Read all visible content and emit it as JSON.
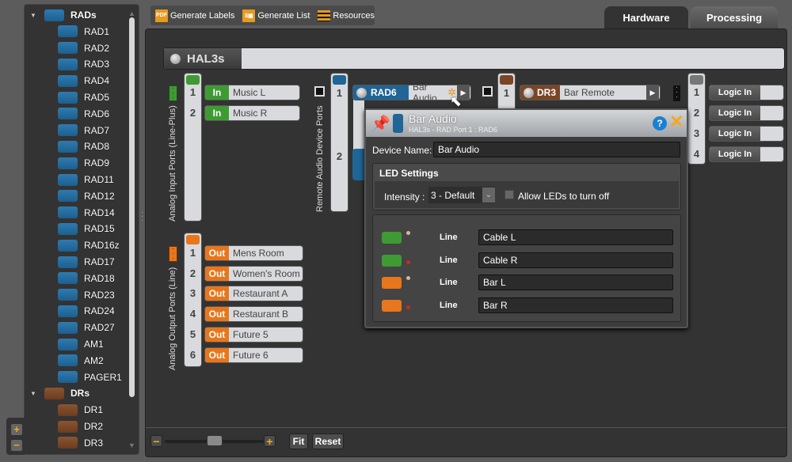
{
  "sidebar": {
    "groups": [
      {
        "label": "RADs",
        "color": "blue",
        "items": [
          "RAD1",
          "RAD2",
          "RAD3",
          "RAD4",
          "RAD5",
          "RAD6",
          "RAD7",
          "RAD8",
          "RAD9",
          "RAD11",
          "RAD12",
          "RAD14",
          "RAD15",
          "RAD16z",
          "RAD17",
          "RAD18",
          "RAD23",
          "RAD24",
          "RAD27",
          "AM1",
          "AM2",
          "PAGER1"
        ]
      },
      {
        "label": "DRs",
        "color": "brown",
        "items": [
          "DR1",
          "DR2",
          "DR3"
        ]
      }
    ],
    "add_label": "+",
    "remove_label": "−"
  },
  "toolbar": {
    "generate_labels": "Generate Labels",
    "generate_list": "Generate List",
    "resources": "Resources",
    "pdf_icon_text": "PDF",
    "list_icon_text": "$▦"
  },
  "tabs": [
    {
      "label": "Hardware",
      "active": true
    },
    {
      "label": "Processing",
      "active": false
    }
  ],
  "device": {
    "name": "HAL3s"
  },
  "inputs": {
    "title": "Analog Input Ports (Line-Plus)",
    "tag": "In",
    "ports": [
      {
        "n": "1",
        "name": "Music L"
      },
      {
        "n": "2",
        "name": "Music R"
      }
    ]
  },
  "outputs": {
    "title": "Analog Output Ports (Line)",
    "tag": "Out",
    "ports": [
      {
        "n": "1",
        "name": "Mens Room"
      },
      {
        "n": "2",
        "name": "Women's Room"
      },
      {
        "n": "3",
        "name": "Restaurant A"
      },
      {
        "n": "4",
        "name": "Restaurant B"
      },
      {
        "n": "5",
        "name": "Future 5"
      },
      {
        "n": "6",
        "name": "Future 6"
      }
    ]
  },
  "remote": {
    "title": "Remote Audio Device Ports",
    "ports": [
      "1",
      "2"
    ],
    "device": {
      "id": "RAD6",
      "name": "Bar Audio"
    }
  },
  "dr": {
    "port": "1",
    "device": {
      "id": "DR3",
      "name": "Bar Remote"
    }
  },
  "logic": {
    "ports": [
      {
        "n": "1",
        "label": "Logic In"
      },
      {
        "n": "2",
        "label": "Logic In"
      },
      {
        "n": "3",
        "label": "Logic In"
      },
      {
        "n": "4",
        "label": "Logic In"
      }
    ]
  },
  "popup": {
    "title": "Bar Audio",
    "subtitle": "HAL3s - RAD Port 1  :  RAD6",
    "device_name_label": "Device Name:",
    "device_name_value": "Bar Audio",
    "led_title": "LED Settings",
    "intensity_label": "Intensity :",
    "intensity_value": "3 - Default",
    "allow_off_label": "Allow LEDs to turn off",
    "allow_off_checked": false,
    "channels": [
      {
        "color": "#3f9a34",
        "type": "Line",
        "name": "Cable L"
      },
      {
        "color": "#3f9a34",
        "type": "Line",
        "name": "Cable R"
      },
      {
        "color": "#e8761c",
        "type": "Line",
        "name": "Bar L"
      },
      {
        "color": "#e8761c",
        "type": "Line",
        "name": "Bar R"
      }
    ]
  },
  "zoom": {
    "level": 0.5,
    "fit": "Fit",
    "reset": "Reset",
    "minus": "−",
    "plus": "+"
  },
  "colors": {
    "rad": "#1f6596",
    "dr": "#7a4626",
    "input": "#3f9a34",
    "output": "#e8761c",
    "accent": "#f2a81d"
  }
}
